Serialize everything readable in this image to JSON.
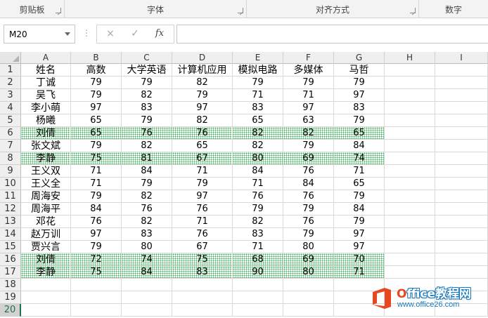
{
  "ribbon": {
    "groups": [
      {
        "label": "剪贴板"
      },
      {
        "label": "字体"
      },
      {
        "label": "对齐方式"
      },
      {
        "label": "数字"
      }
    ]
  },
  "formula_bar": {
    "name_box": "M20",
    "cancel_icon": "×",
    "enter_icon": "✓",
    "fx_label": "fx",
    "formula": ""
  },
  "columns": [
    "A",
    "B",
    "C",
    "D",
    "E",
    "F",
    "G",
    "H",
    "I"
  ],
  "row_numbers": [
    "1",
    "2",
    "3",
    "4",
    "5",
    "6",
    "7",
    "8",
    "9",
    "10",
    "11",
    "12",
    "13",
    "14",
    "15",
    "16",
    "17",
    "18",
    "19",
    "20"
  ],
  "active_row": "20",
  "highlight_color": "#3fae5b",
  "header_row": [
    "姓名",
    "高数",
    "大学英语",
    "计算机应用",
    "模拟电路",
    "多媒体",
    "马哲"
  ],
  "data_rows": [
    {
      "name": "丁诚",
      "scores": [
        "79",
        "79",
        "82",
        "79",
        "79",
        "79"
      ],
      "highlight": false
    },
    {
      "name": "吴飞",
      "scores": [
        "79",
        "82",
        "79",
        "71",
        "71",
        "97"
      ],
      "highlight": false
    },
    {
      "name": "李小萌",
      "scores": [
        "97",
        "83",
        "97",
        "83",
        "97",
        "83"
      ],
      "highlight": false
    },
    {
      "name": "杨曦",
      "scores": [
        "65",
        "79",
        "82",
        "65",
        "63",
        "79"
      ],
      "highlight": false
    },
    {
      "name": "刘倩",
      "scores": [
        "65",
        "76",
        "76",
        "82",
        "82",
        "65"
      ],
      "highlight": true
    },
    {
      "name": "张文斌",
      "scores": [
        "79",
        "82",
        "65",
        "82",
        "79",
        "84"
      ],
      "highlight": false
    },
    {
      "name": "李静",
      "scores": [
        "75",
        "81",
        "67",
        "80",
        "69",
        "74"
      ],
      "highlight": true
    },
    {
      "name": "王义双",
      "scores": [
        "71",
        "84",
        "71",
        "84",
        "76",
        "71"
      ],
      "highlight": false
    },
    {
      "name": "王义全",
      "scores": [
        "71",
        "79",
        "79",
        "71",
        "84",
        "65"
      ],
      "highlight": false
    },
    {
      "name": "周海安",
      "scores": [
        "79",
        "82",
        "97",
        "76",
        "76",
        "79"
      ],
      "highlight": false
    },
    {
      "name": "周海平",
      "scores": [
        "84",
        "76",
        "76",
        "79",
        "79",
        "84"
      ],
      "highlight": false
    },
    {
      "name": "邓花",
      "scores": [
        "76",
        "82",
        "71",
        "82",
        "76",
        "79"
      ],
      "highlight": false
    },
    {
      "name": "赵万训",
      "scores": [
        "97",
        "83",
        "76",
        "83",
        "79",
        "97"
      ],
      "highlight": false
    },
    {
      "name": "贾兴言",
      "scores": [
        "79",
        "80",
        "67",
        "71",
        "80",
        "97"
      ],
      "highlight": false
    },
    {
      "name": "刘倩",
      "scores": [
        "72",
        "74",
        "75",
        "68",
        "69",
        "70"
      ],
      "highlight": true
    },
    {
      "name": "李静",
      "scores": [
        "75",
        "84",
        "83",
        "90",
        "80",
        "71"
      ],
      "highlight": true
    }
  ],
  "watermark": {
    "brand_prefix": "O",
    "brand_rest": "ffice教程网",
    "url": "www.office26.com",
    "logo_color": "#e8481f"
  }
}
